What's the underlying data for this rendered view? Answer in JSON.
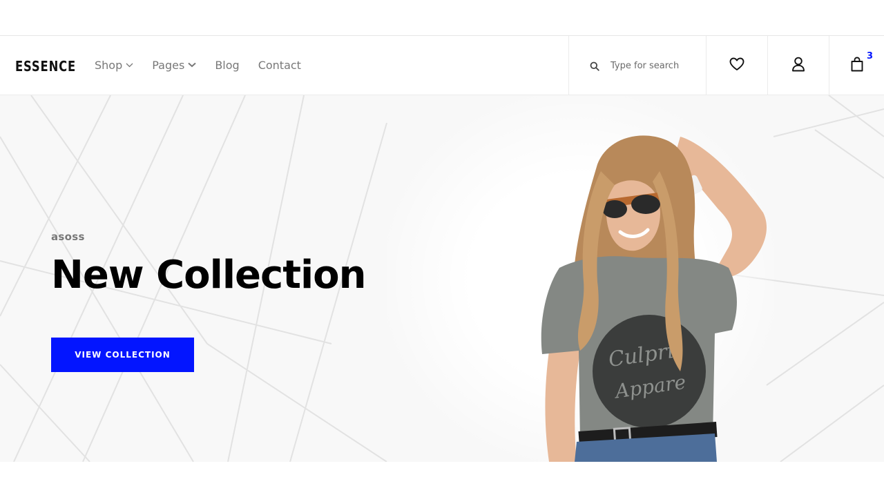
{
  "brand": {
    "logo": "ESSENCE"
  },
  "nav": {
    "items": [
      {
        "label": "Shop",
        "has_dropdown": true
      },
      {
        "label": "Pages",
        "has_dropdown": true
      },
      {
        "label": "Blog",
        "has_dropdown": false
      },
      {
        "label": "Contact",
        "has_dropdown": false
      }
    ]
  },
  "search": {
    "placeholder": "Type for search",
    "icon": "search-icon"
  },
  "header_icons": {
    "favorites": "heart-icon",
    "account": "user-icon",
    "cart": "bag-icon",
    "cart_count": "3"
  },
  "hero": {
    "subtitle": "asoss",
    "title": "New Collection",
    "cta_label": "VIEW COLLECTION"
  },
  "colors": {
    "accent": "#0315ff",
    "text_dark": "#000000",
    "text_muted": "#787878",
    "hero_bg": "#f8f8f8"
  }
}
